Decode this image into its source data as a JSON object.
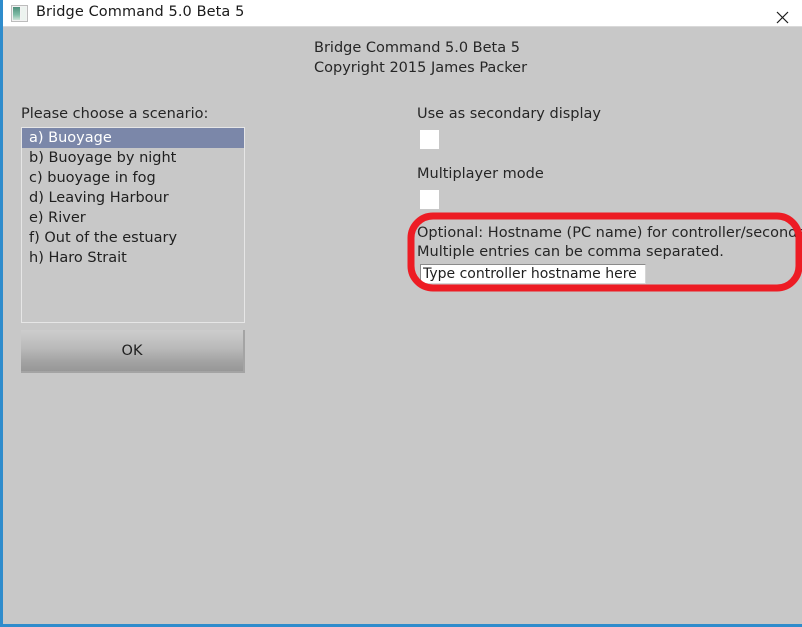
{
  "window": {
    "title": "Bridge Command 5.0 Beta 5",
    "icon": "app-icon",
    "close_label": "×",
    "accent_color": "#2f8ccc",
    "background_color": "#c8c8c8"
  },
  "header": {
    "line1": "Bridge Command 5.0 Beta 5",
    "line2": "Copyright 2015 James Packer"
  },
  "scenario": {
    "label": "Please choose a scenario:",
    "selected_index": 0,
    "highlight_color": "#7b87a9",
    "items": [
      {
        "label": "a) Buoyage"
      },
      {
        "label": "b) Buoyage by night"
      },
      {
        "label": "c) buoyage in fog"
      },
      {
        "label": "d) Leaving Harbour"
      },
      {
        "label": "e) River"
      },
      {
        "label": "f) Out of the estuary"
      },
      {
        "label": "h) Haro Strait"
      }
    ]
  },
  "ok_button": {
    "label": "OK"
  },
  "options": {
    "secondary_display": {
      "label": "Use as secondary display",
      "checked": false
    },
    "multiplayer": {
      "label": "Multiplayer mode",
      "checked": false
    }
  },
  "hostname": {
    "description_line1": "Optional: Hostname (PC name) for controller/secondary display.",
    "description_line2": "Multiple entries can be comma separated.",
    "input_value": "Type controller hostname here",
    "input_placeholder": "Type controller hostname here"
  },
  "annotation": {
    "shape": "rounded-rectangle",
    "color": "#ed1c24",
    "stroke_width": 7
  }
}
